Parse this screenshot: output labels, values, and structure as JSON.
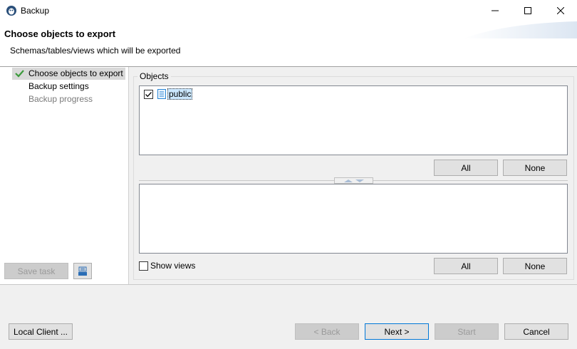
{
  "window": {
    "title": "Backup",
    "minimize_icon": "minimize-icon",
    "maximize_icon": "maximize-icon",
    "close_icon": "close-icon"
  },
  "header": {
    "title": "Choose objects to export",
    "description": "Schemas/tables/views which will be exported"
  },
  "nav": {
    "items": [
      {
        "label": "Choose objects to export",
        "state": "active",
        "icon": "check-icon"
      },
      {
        "label": "Backup settings",
        "state": "enabled"
      },
      {
        "label": "Backup progress",
        "state": "disabled"
      }
    ],
    "save_task_label": "Save task",
    "save_icon": "save-task-icon"
  },
  "objects": {
    "group_label": "Objects",
    "schemas": [
      {
        "label": "public",
        "checked": true,
        "icon": "schema-icon"
      }
    ],
    "all_label": "All",
    "none_label": "None",
    "tables_all_label": "All",
    "tables_none_label": "None",
    "show_views_label": "Show views",
    "show_views_checked": false
  },
  "footer": {
    "local_client_label": "Local Client ...",
    "back_label": "< Back",
    "back_mnemonic": "B",
    "next_label": "Next >",
    "next_mnemonic": "N",
    "start_label": "Start",
    "cancel_label": "Cancel"
  },
  "colors": {
    "accent": "#0078d7",
    "check_green": "#3c9b3c",
    "selection": "#cce8ff",
    "panel": "#f0f0f0"
  }
}
